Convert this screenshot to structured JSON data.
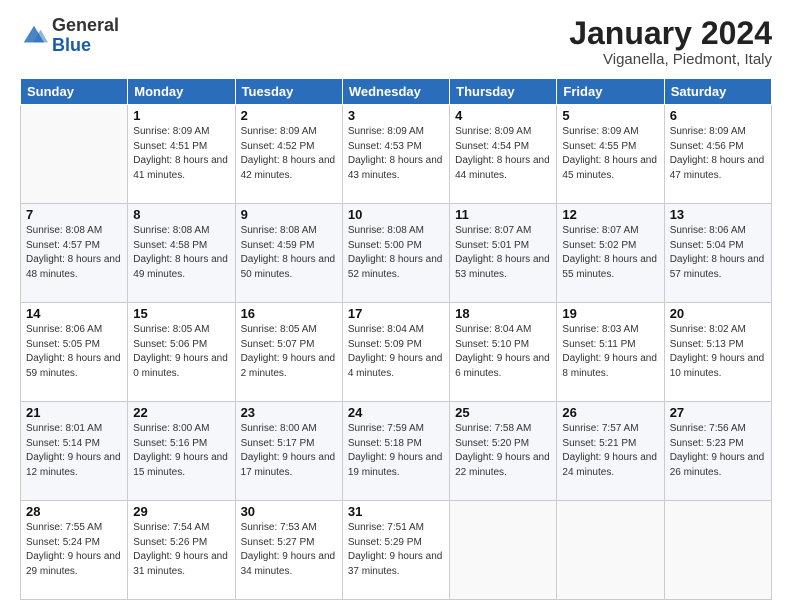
{
  "logo": {
    "general": "General",
    "blue": "Blue"
  },
  "header": {
    "month": "January 2024",
    "location": "Viganella, Piedmont, Italy"
  },
  "weekdays": [
    "Sunday",
    "Monday",
    "Tuesday",
    "Wednesday",
    "Thursday",
    "Friday",
    "Saturday"
  ],
  "weeks": [
    [
      {
        "day": "",
        "sunrise": "",
        "sunset": "",
        "daylight": ""
      },
      {
        "day": "1",
        "sunrise": "Sunrise: 8:09 AM",
        "sunset": "Sunset: 4:51 PM",
        "daylight": "Daylight: 8 hours and 41 minutes."
      },
      {
        "day": "2",
        "sunrise": "Sunrise: 8:09 AM",
        "sunset": "Sunset: 4:52 PM",
        "daylight": "Daylight: 8 hours and 42 minutes."
      },
      {
        "day": "3",
        "sunrise": "Sunrise: 8:09 AM",
        "sunset": "Sunset: 4:53 PM",
        "daylight": "Daylight: 8 hours and 43 minutes."
      },
      {
        "day": "4",
        "sunrise": "Sunrise: 8:09 AM",
        "sunset": "Sunset: 4:54 PM",
        "daylight": "Daylight: 8 hours and 44 minutes."
      },
      {
        "day": "5",
        "sunrise": "Sunrise: 8:09 AM",
        "sunset": "Sunset: 4:55 PM",
        "daylight": "Daylight: 8 hours and 45 minutes."
      },
      {
        "day": "6",
        "sunrise": "Sunrise: 8:09 AM",
        "sunset": "Sunset: 4:56 PM",
        "daylight": "Daylight: 8 hours and 47 minutes."
      }
    ],
    [
      {
        "day": "7",
        "sunrise": "Sunrise: 8:08 AM",
        "sunset": "Sunset: 4:57 PM",
        "daylight": "Daylight: 8 hours and 48 minutes."
      },
      {
        "day": "8",
        "sunrise": "Sunrise: 8:08 AM",
        "sunset": "Sunset: 4:58 PM",
        "daylight": "Daylight: 8 hours and 49 minutes."
      },
      {
        "day": "9",
        "sunrise": "Sunrise: 8:08 AM",
        "sunset": "Sunset: 4:59 PM",
        "daylight": "Daylight: 8 hours and 50 minutes."
      },
      {
        "day": "10",
        "sunrise": "Sunrise: 8:08 AM",
        "sunset": "Sunset: 5:00 PM",
        "daylight": "Daylight: 8 hours and 52 minutes."
      },
      {
        "day": "11",
        "sunrise": "Sunrise: 8:07 AM",
        "sunset": "Sunset: 5:01 PM",
        "daylight": "Daylight: 8 hours and 53 minutes."
      },
      {
        "day": "12",
        "sunrise": "Sunrise: 8:07 AM",
        "sunset": "Sunset: 5:02 PM",
        "daylight": "Daylight: 8 hours and 55 minutes."
      },
      {
        "day": "13",
        "sunrise": "Sunrise: 8:06 AM",
        "sunset": "Sunset: 5:04 PM",
        "daylight": "Daylight: 8 hours and 57 minutes."
      }
    ],
    [
      {
        "day": "14",
        "sunrise": "Sunrise: 8:06 AM",
        "sunset": "Sunset: 5:05 PM",
        "daylight": "Daylight: 8 hours and 59 minutes."
      },
      {
        "day": "15",
        "sunrise": "Sunrise: 8:05 AM",
        "sunset": "Sunset: 5:06 PM",
        "daylight": "Daylight: 9 hours and 0 minutes."
      },
      {
        "day": "16",
        "sunrise": "Sunrise: 8:05 AM",
        "sunset": "Sunset: 5:07 PM",
        "daylight": "Daylight: 9 hours and 2 minutes."
      },
      {
        "day": "17",
        "sunrise": "Sunrise: 8:04 AM",
        "sunset": "Sunset: 5:09 PM",
        "daylight": "Daylight: 9 hours and 4 minutes."
      },
      {
        "day": "18",
        "sunrise": "Sunrise: 8:04 AM",
        "sunset": "Sunset: 5:10 PM",
        "daylight": "Daylight: 9 hours and 6 minutes."
      },
      {
        "day": "19",
        "sunrise": "Sunrise: 8:03 AM",
        "sunset": "Sunset: 5:11 PM",
        "daylight": "Daylight: 9 hours and 8 minutes."
      },
      {
        "day": "20",
        "sunrise": "Sunrise: 8:02 AM",
        "sunset": "Sunset: 5:13 PM",
        "daylight": "Daylight: 9 hours and 10 minutes."
      }
    ],
    [
      {
        "day": "21",
        "sunrise": "Sunrise: 8:01 AM",
        "sunset": "Sunset: 5:14 PM",
        "daylight": "Daylight: 9 hours and 12 minutes."
      },
      {
        "day": "22",
        "sunrise": "Sunrise: 8:00 AM",
        "sunset": "Sunset: 5:16 PM",
        "daylight": "Daylight: 9 hours and 15 minutes."
      },
      {
        "day": "23",
        "sunrise": "Sunrise: 8:00 AM",
        "sunset": "Sunset: 5:17 PM",
        "daylight": "Daylight: 9 hours and 17 minutes."
      },
      {
        "day": "24",
        "sunrise": "Sunrise: 7:59 AM",
        "sunset": "Sunset: 5:18 PM",
        "daylight": "Daylight: 9 hours and 19 minutes."
      },
      {
        "day": "25",
        "sunrise": "Sunrise: 7:58 AM",
        "sunset": "Sunset: 5:20 PM",
        "daylight": "Daylight: 9 hours and 22 minutes."
      },
      {
        "day": "26",
        "sunrise": "Sunrise: 7:57 AM",
        "sunset": "Sunset: 5:21 PM",
        "daylight": "Daylight: 9 hours and 24 minutes."
      },
      {
        "day": "27",
        "sunrise": "Sunrise: 7:56 AM",
        "sunset": "Sunset: 5:23 PM",
        "daylight": "Daylight: 9 hours and 26 minutes."
      }
    ],
    [
      {
        "day": "28",
        "sunrise": "Sunrise: 7:55 AM",
        "sunset": "Sunset: 5:24 PM",
        "daylight": "Daylight: 9 hours and 29 minutes."
      },
      {
        "day": "29",
        "sunrise": "Sunrise: 7:54 AM",
        "sunset": "Sunset: 5:26 PM",
        "daylight": "Daylight: 9 hours and 31 minutes."
      },
      {
        "day": "30",
        "sunrise": "Sunrise: 7:53 AM",
        "sunset": "Sunset: 5:27 PM",
        "daylight": "Daylight: 9 hours and 34 minutes."
      },
      {
        "day": "31",
        "sunrise": "Sunrise: 7:51 AM",
        "sunset": "Sunset: 5:29 PM",
        "daylight": "Daylight: 9 hours and 37 minutes."
      },
      {
        "day": "",
        "sunrise": "",
        "sunset": "",
        "daylight": ""
      },
      {
        "day": "",
        "sunrise": "",
        "sunset": "",
        "daylight": ""
      },
      {
        "day": "",
        "sunrise": "",
        "sunset": "",
        "daylight": ""
      }
    ]
  ]
}
